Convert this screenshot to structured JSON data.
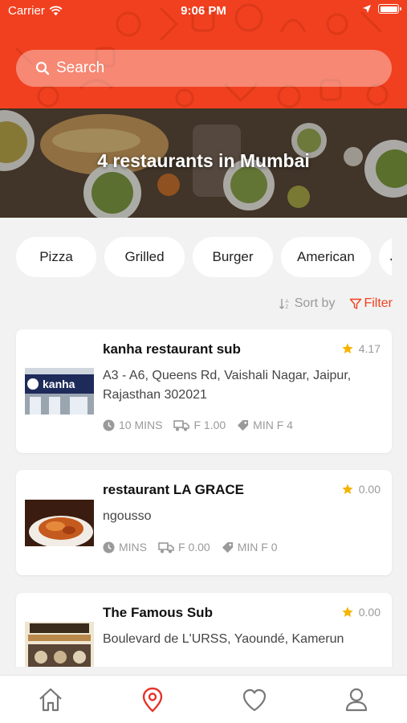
{
  "status_bar": {
    "carrier": "Carrier",
    "time": "9:06 PM"
  },
  "search": {
    "placeholder": "Search"
  },
  "hero": {
    "title": "4 restaurants in Mumbai"
  },
  "categories": [
    "Pizza",
    "Grilled",
    "Burger",
    "American",
    "Ja"
  ],
  "sort": {
    "sort_label": "Sort by",
    "filter_label": "Filter"
  },
  "restaurants": [
    {
      "name": "kanha restaurant sub",
      "rating": "4.17",
      "address": "A3 - A6, Queens Rd, Vaishali Nagar, Jaipur, Rajasthan 302021",
      "time": "10 MINS",
      "fee": "F 1.00",
      "min": "MIN F 4",
      "thumb_text": "kanha"
    },
    {
      "name": "restaurant LA GRACE",
      "rating": "0.00",
      "address": "ngousso",
      "time": "MINS",
      "fee": "F 0.00",
      "min": "MIN F 0"
    },
    {
      "name": "The Famous Sub",
      "rating": "0.00",
      "address": "Boulevard de L'URSS, Yaoundé, Kamerun"
    }
  ],
  "tabs": [
    {
      "icon": "home-icon"
    },
    {
      "icon": "location-pin-icon"
    },
    {
      "icon": "heart-icon"
    },
    {
      "icon": "user-icon"
    }
  ],
  "colors": {
    "accent": "#f1401f",
    "star": "#f5b400",
    "muted": "#9a9a9a"
  }
}
